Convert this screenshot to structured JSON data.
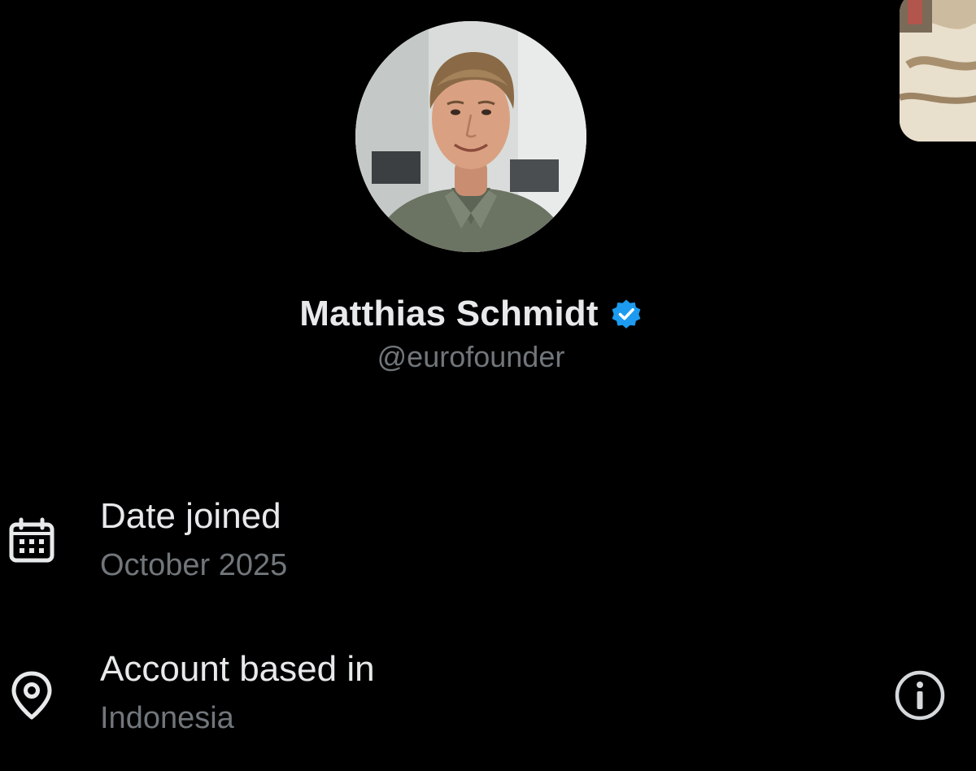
{
  "profile": {
    "display_name": "Matthias Schmidt",
    "handle": "@eurofounder",
    "verified": true,
    "verified_color": "#1d9bf0"
  },
  "details": {
    "date_joined": {
      "icon": "calendar-icon",
      "title": "Date joined",
      "value": "October 2025"
    },
    "account_based_in": {
      "icon": "location-pin-icon",
      "title": "Account based in",
      "value": "Indonesia",
      "info_icon": "info-icon"
    }
  },
  "colors": {
    "background": "#000000",
    "primary_text": "#e7e9ea",
    "secondary_text": "#71767b"
  }
}
